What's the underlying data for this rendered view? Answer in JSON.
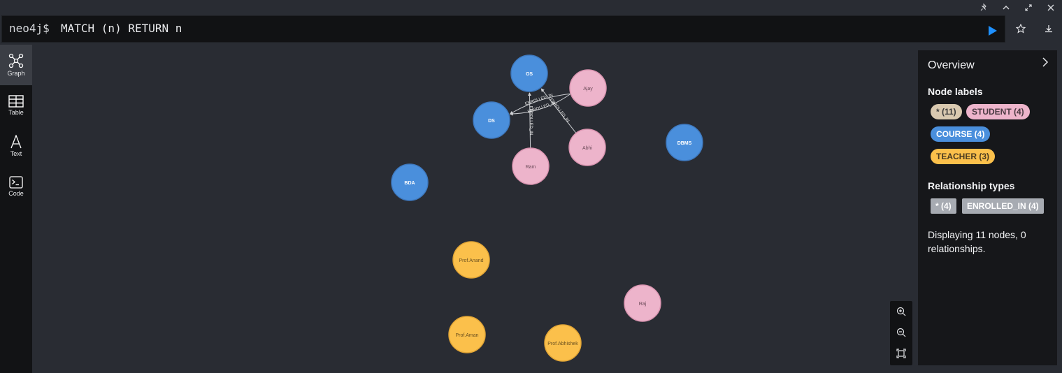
{
  "editor": {
    "prompt": "neo4j$",
    "query": "MATCH (n) RETURN n"
  },
  "sidebar": {
    "items": [
      {
        "label": "Graph",
        "icon": "graph-icon",
        "active": true
      },
      {
        "label": "Table",
        "icon": "table-icon",
        "active": false
      },
      {
        "label": "Text",
        "icon": "text-icon",
        "active": false
      },
      {
        "label": "Code",
        "icon": "code-icon",
        "active": false
      }
    ]
  },
  "colors": {
    "course": "#4a8fdc",
    "student": "#edb4cb",
    "teacher": "#fbc04b",
    "star_pill": "#d9c9b0",
    "rel_tag": "#a7abb2",
    "run": "#1e90ff"
  },
  "graph": {
    "nodes": [
      {
        "id": "os",
        "label": "OS",
        "type": "course"
      },
      {
        "id": "ds",
        "label": "DS",
        "type": "course"
      },
      {
        "id": "dbms",
        "label": "DBMS",
        "type": "course"
      },
      {
        "id": "bda",
        "label": "BDA",
        "type": "course"
      },
      {
        "id": "ajay",
        "label": "Ajay",
        "type": "student"
      },
      {
        "id": "abhi",
        "label": "Abhi",
        "type": "student"
      },
      {
        "id": "ram",
        "label": "Ram",
        "type": "student"
      },
      {
        "id": "raj",
        "label": "Raj",
        "type": "student"
      },
      {
        "id": "anand",
        "label": "Prof.Anand",
        "type": "teacher"
      },
      {
        "id": "aman",
        "label": "Prof.Aman",
        "type": "teacher"
      },
      {
        "id": "abhishek",
        "label": "Prof.Abhishek",
        "type": "teacher"
      }
    ],
    "relationships": [
      {
        "from": "ajay",
        "to": "ds",
        "label": "ENROLLED_IN"
      },
      {
        "from": "ajay",
        "to": "ds",
        "label": "ENROLLED_IN"
      },
      {
        "from": "ram",
        "to": "os",
        "label": "ENROLLED_IN"
      },
      {
        "from": "abhi",
        "to": "os",
        "label": "ENROLLED_IN"
      }
    ]
  },
  "overview": {
    "title": "Overview",
    "node_labels_heading": "Node labels",
    "node_labels": [
      {
        "text": "* (11)",
        "type": "all"
      },
      {
        "text": "STUDENT (4)",
        "type": "student"
      },
      {
        "text": "COURSE (4)",
        "type": "course"
      },
      {
        "text": "TEACHER (3)",
        "type": "teacher"
      }
    ],
    "rel_types_heading": "Relationship types",
    "rel_types": [
      {
        "text": "* (4)"
      },
      {
        "text": "ENROLLED_IN (4)"
      }
    ],
    "description": "Displaying 11 nodes, 0 relationships."
  }
}
